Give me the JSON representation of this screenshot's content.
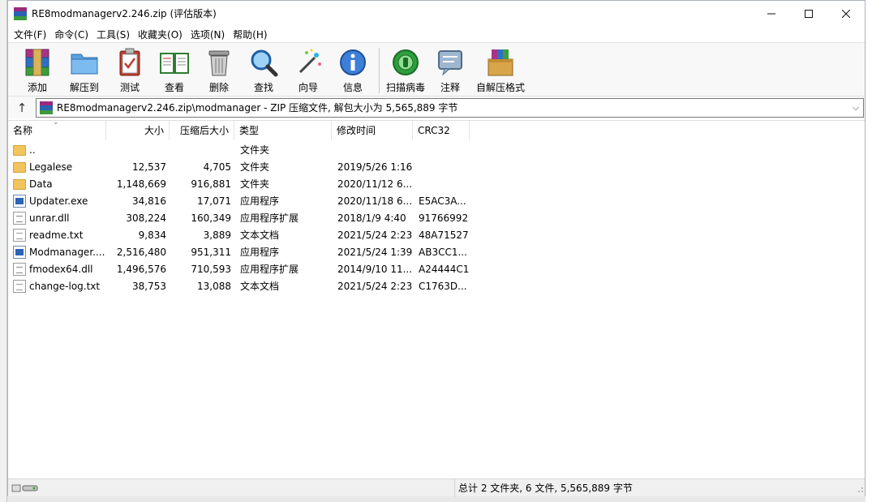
{
  "window": {
    "title": "RE8modmanagerv2.246.zip (评估版本)",
    "controls": {
      "minimize": "—",
      "maximize": "☐",
      "close": "✕"
    }
  },
  "menu": [
    "文件(F)",
    "命令(C)",
    "工具(S)",
    "收藏夹(O)",
    "选项(N)",
    "帮助(H)"
  ],
  "toolbar": {
    "add": "添加",
    "extract_to": "解压到",
    "test": "测试",
    "view": "查看",
    "delete": "删除",
    "find": "查找",
    "wizard": "向导",
    "info": "信息",
    "virus_scan": "扫描病毒",
    "comment": "注释",
    "sfx": "自解压格式"
  },
  "address": {
    "up_arrow": "↑",
    "path": "RE8modmanagerv2.246.zip\\modmanager - ZIP 压缩文件, 解包大小为 5,565,889 字节",
    "dropdown": "⌵"
  },
  "columns": {
    "name": "名称",
    "size": "大小",
    "packed": "压缩后大小",
    "type": "类型",
    "modified": "修改时间",
    "crc": "CRC32",
    "sort_indicator": "⌄"
  },
  "files": [
    {
      "icon": "folder",
      "name": "..",
      "size": "",
      "packed": "",
      "type": "文件夹",
      "modified": "",
      "crc": ""
    },
    {
      "icon": "folder",
      "name": "Legalese",
      "size": "12,537",
      "packed": "4,705",
      "type": "文件夹",
      "modified": "2019/5/26 1:16",
      "crc": ""
    },
    {
      "icon": "folder",
      "name": "Data",
      "size": "1,148,669",
      "packed": "916,881",
      "type": "文件夹",
      "modified": "2020/11/12 6...",
      "crc": ""
    },
    {
      "icon": "exe",
      "name": "Updater.exe",
      "size": "34,816",
      "packed": "17,071",
      "type": "应用程序",
      "modified": "2020/11/18 6...",
      "crc": "E5AC3A..."
    },
    {
      "icon": "dll",
      "name": "unrar.dll",
      "size": "308,224",
      "packed": "160,349",
      "type": "应用程序扩展",
      "modified": "2018/1/9 4:40",
      "crc": "91766992"
    },
    {
      "icon": "txt",
      "name": "readme.txt",
      "size": "9,834",
      "packed": "3,889",
      "type": "文本文档",
      "modified": "2021/5/24 2:23",
      "crc": "48A71527"
    },
    {
      "icon": "exe",
      "name": "Modmanager....",
      "size": "2,516,480",
      "packed": "951,311",
      "type": "应用程序",
      "modified": "2021/5/24 1:39",
      "crc": "AB3CC1..."
    },
    {
      "icon": "dll",
      "name": "fmodex64.dll",
      "size": "1,496,576",
      "packed": "710,593",
      "type": "应用程序扩展",
      "modified": "2014/9/10 11...",
      "crc": "A24444C1"
    },
    {
      "icon": "txt",
      "name": "change-log.txt",
      "size": "38,753",
      "packed": "13,088",
      "type": "文本文档",
      "modified": "2021/5/24 2:23",
      "crc": "C1763D..."
    }
  ],
  "status": {
    "summary": "总计 2 文件夹, 6 文件, 5,565,889 字节"
  }
}
